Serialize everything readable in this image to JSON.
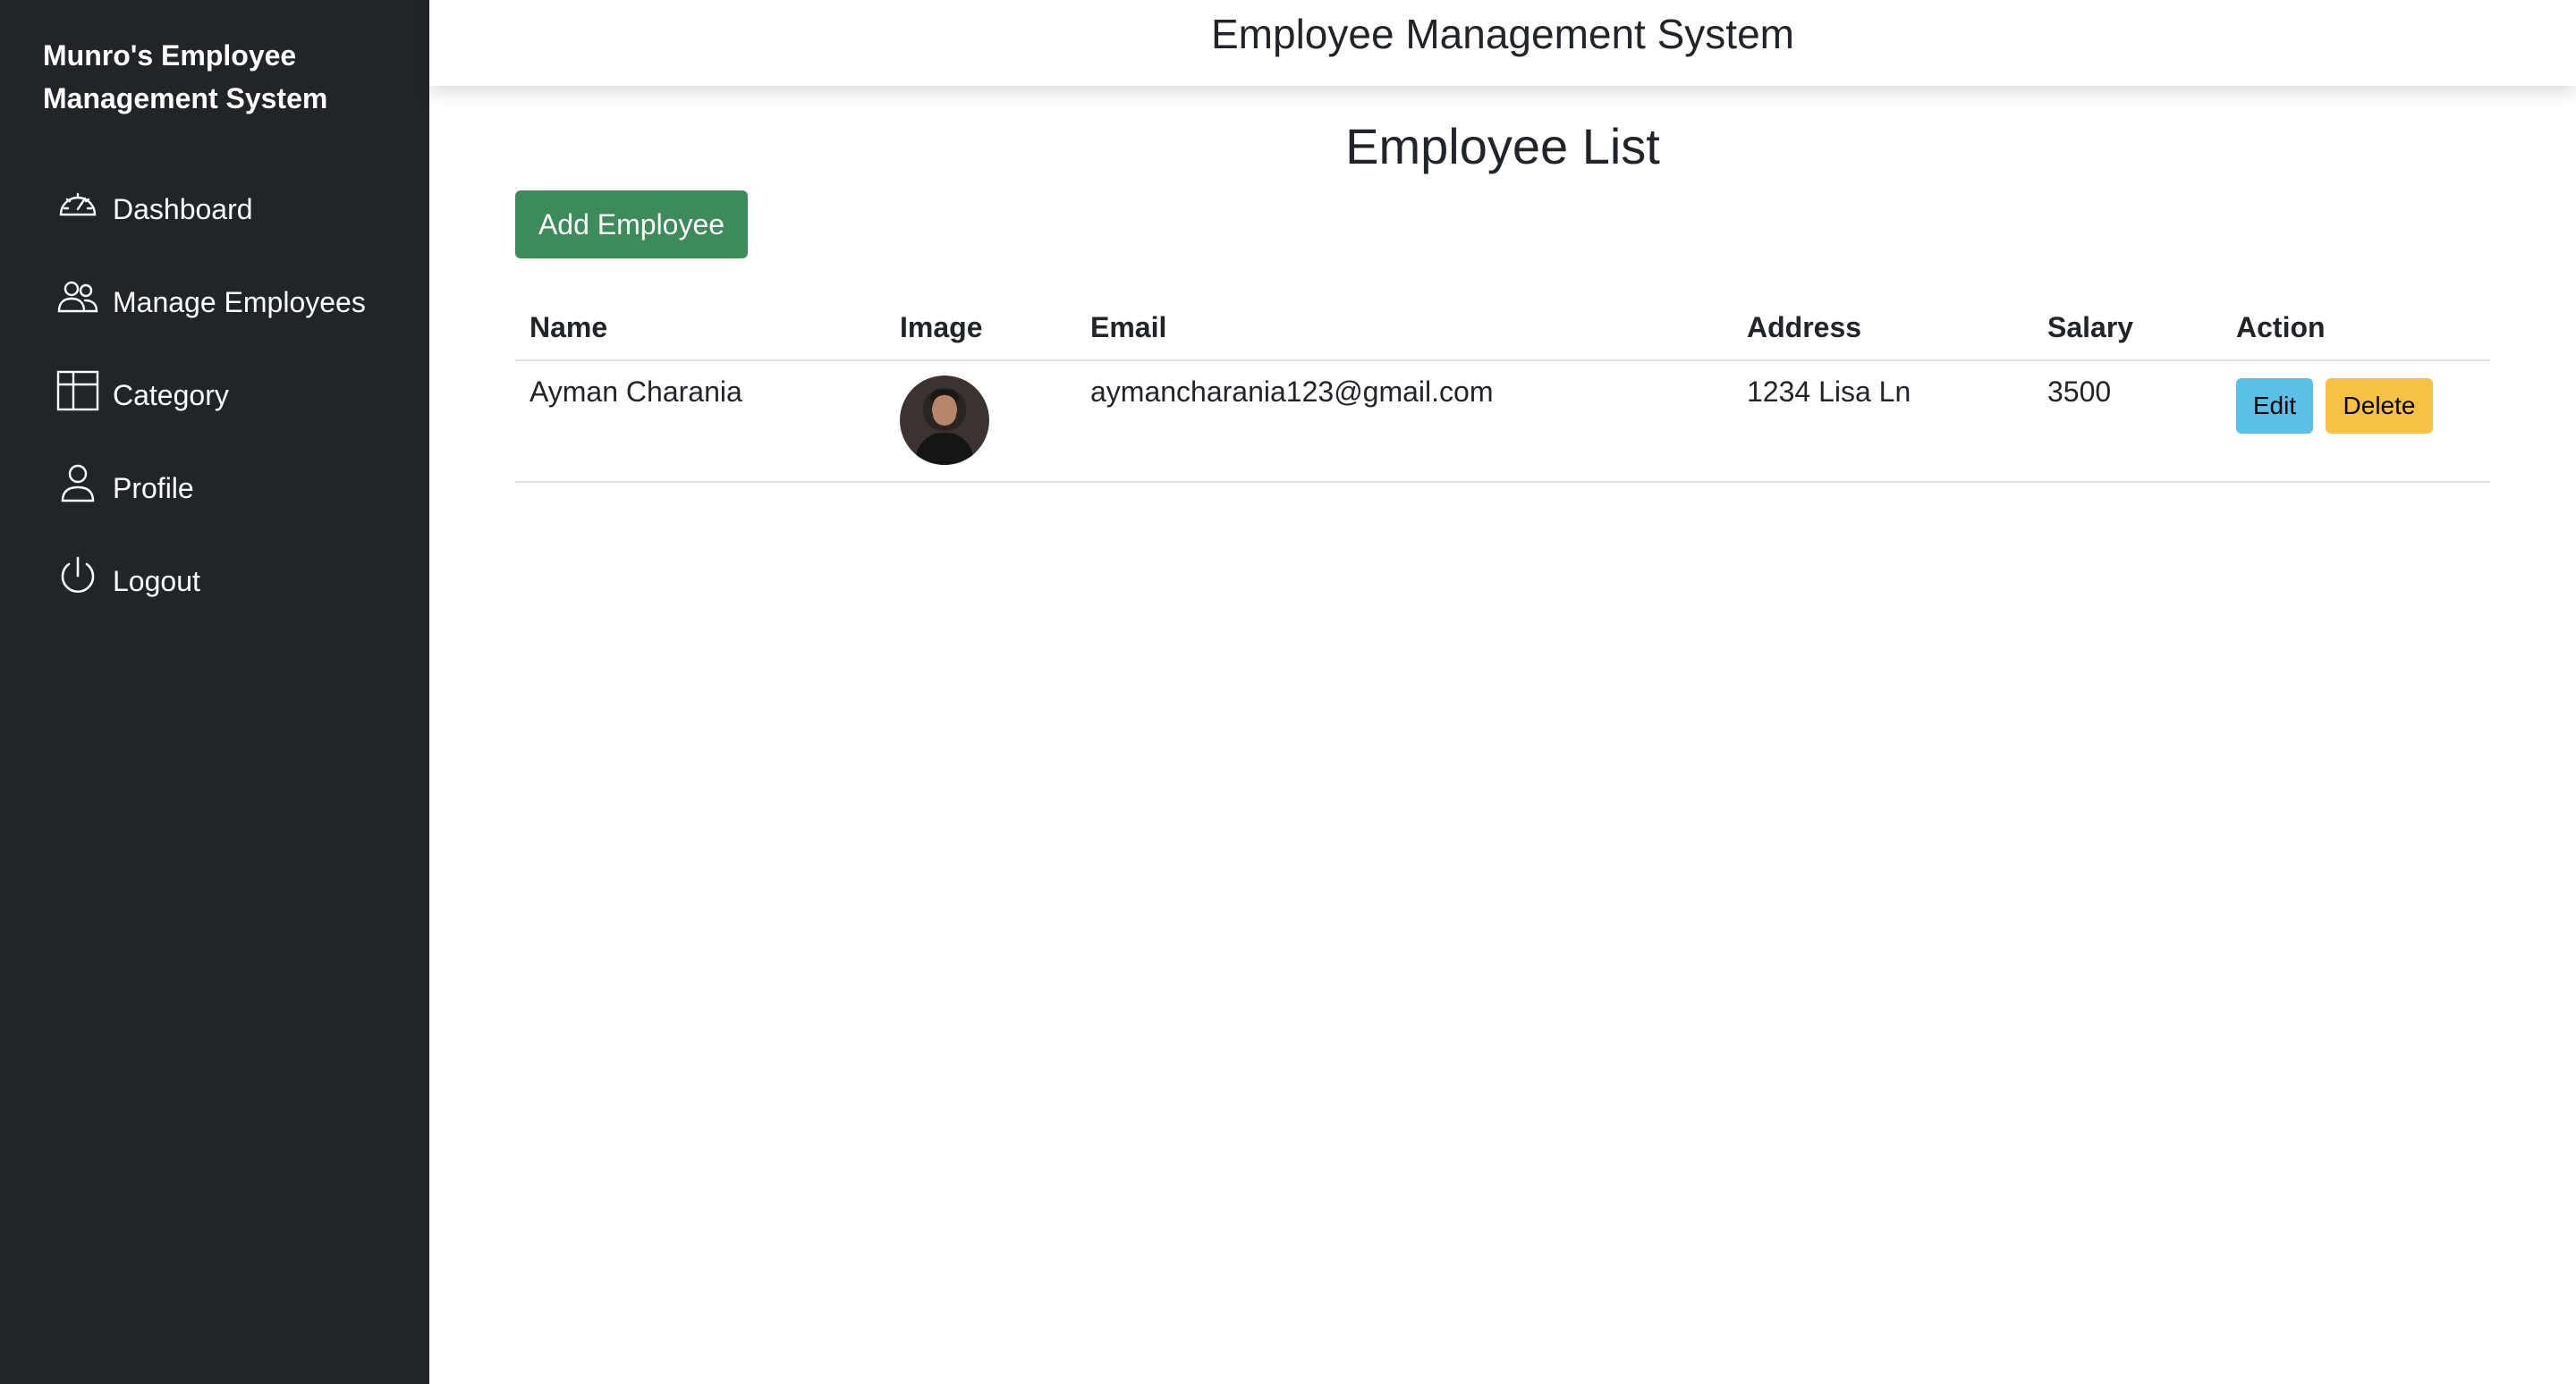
{
  "sidebar": {
    "brand": "Munro's Employee Management System",
    "items": [
      {
        "label": "Dashboard",
        "icon": "speedometer-icon"
      },
      {
        "label": "Manage Employees",
        "icon": "people-icon"
      },
      {
        "label": "Category",
        "icon": "columns-icon"
      },
      {
        "label": "Profile",
        "icon": "person-icon"
      },
      {
        "label": "Logout",
        "icon": "power-icon"
      }
    ]
  },
  "header": {
    "title": "Employee Management System"
  },
  "main": {
    "title": "Employee List",
    "add_button": "Add Employee",
    "table": {
      "columns": [
        "Name",
        "Image",
        "Email",
        "Address",
        "Salary",
        "Action"
      ],
      "rows": [
        {
          "name": "Ayman Charania",
          "image": "avatar",
          "email": "aymancharania123@gmail.com",
          "address": "1234 Lisa Ln",
          "salary": "3500",
          "edit_label": "Edit",
          "delete_label": "Delete"
        }
      ]
    }
  },
  "colors": {
    "sidebar_bg": "#212529",
    "add_button": "#3d8a5a",
    "edit_button": "#5bc0e8",
    "delete_button": "#f7c244"
  }
}
